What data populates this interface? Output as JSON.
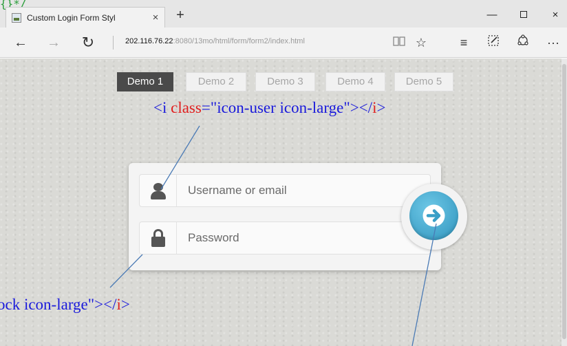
{
  "browser": {
    "tab_title": "Custom Login Form Styl",
    "tab_close": "×",
    "new_tab": "+",
    "url_host": "202.116.76.22",
    "url_rest": ":8080/13mo/html/form/form2/index.html",
    "window_controls": {
      "minimize": "—",
      "close": "×"
    },
    "more": "···"
  },
  "page": {
    "demo_tabs": [
      {
        "label": "Demo 1",
        "active": true
      },
      {
        "label": "Demo 2",
        "active": false
      },
      {
        "label": "Demo 3",
        "active": false
      },
      {
        "label": "Demo 4",
        "active": false
      },
      {
        "label": "Demo 5",
        "active": false
      }
    ],
    "username_placeholder": "Username or email",
    "password_placeholder": "Password"
  },
  "annotations": {
    "note1": {
      "open": "<i ",
      "attr": "class",
      "value": "=\"icon-user icon-large\"></",
      "tag": "i",
      "close": ">"
    },
    "note2": {
      "value": "ock icon-large\"></",
      "tag": "i",
      "close": ">"
    }
  },
  "icons": {
    "user": "user-icon",
    "lock": "lock-icon",
    "submit": "arrow-right-icon"
  },
  "colors": {
    "accent_blue": "#3aa6cf",
    "annotation_blue": "#1a1adb",
    "annotation_red": "#e01e1e",
    "line_color": "#4a7ab5"
  }
}
